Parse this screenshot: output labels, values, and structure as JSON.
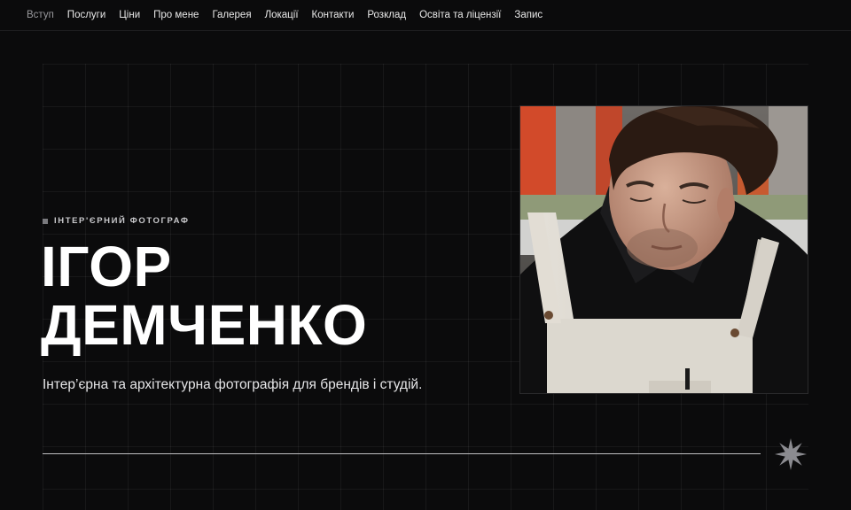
{
  "nav": {
    "items": [
      {
        "label": "Вступ",
        "active": true
      },
      {
        "label": "Послуги"
      },
      {
        "label": "Ціни"
      },
      {
        "label": "Про мене"
      },
      {
        "label": "Галерея"
      },
      {
        "label": "Локації"
      },
      {
        "label": "Контакти"
      },
      {
        "label": "Розклад"
      },
      {
        "label": "Освіта та ліцензії"
      },
      {
        "label": "Запис"
      }
    ]
  },
  "hero": {
    "eyebrow": "ІНТЕР'ЄРНИЙ ФОТОГРАФ",
    "name_line1": "ІГОР",
    "name_line2": "ДЕМЧЕНКО",
    "tagline": "Інтер’єрна та архітектурна фотографія для брендів і студій.",
    "photo_icon": "portrait-photo",
    "decor_icon": "star-icon"
  },
  "colors": {
    "background": "#0b0b0c",
    "text": "#ffffff",
    "muted": "#9a9a9e"
  }
}
